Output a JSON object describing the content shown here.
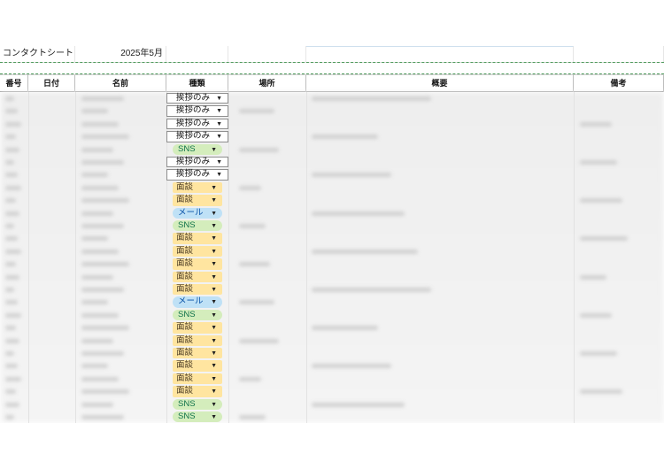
{
  "sheet": {
    "title": "コンタクトシート",
    "month": "2025年5月"
  },
  "headers": [
    "番号",
    "日付",
    "名前",
    "種類",
    "場所",
    "概要",
    "備考"
  ],
  "contact_types": [
    "挨拶のみ",
    "挨拶のみ",
    "挨拶のみ",
    "挨拶のみ",
    "SNS",
    "挨拶のみ",
    "挨拶のみ",
    "面談",
    "面談",
    "メール",
    "SNS",
    "面談",
    "面談",
    "面談",
    "面談",
    "面談",
    "メール",
    "SNS",
    "面談",
    "面談",
    "面談",
    "面談",
    "面談",
    "面談",
    "SNS",
    "SNS"
  ],
  "colors": {
    "sns_bg": "#d4edbc",
    "mendan_bg": "#ffe5a0",
    "mail_bg": "#bfe1f6",
    "gridline": "#e2e2e2"
  },
  "icons": {
    "dropdown": "dropdown-arrow-icon"
  }
}
